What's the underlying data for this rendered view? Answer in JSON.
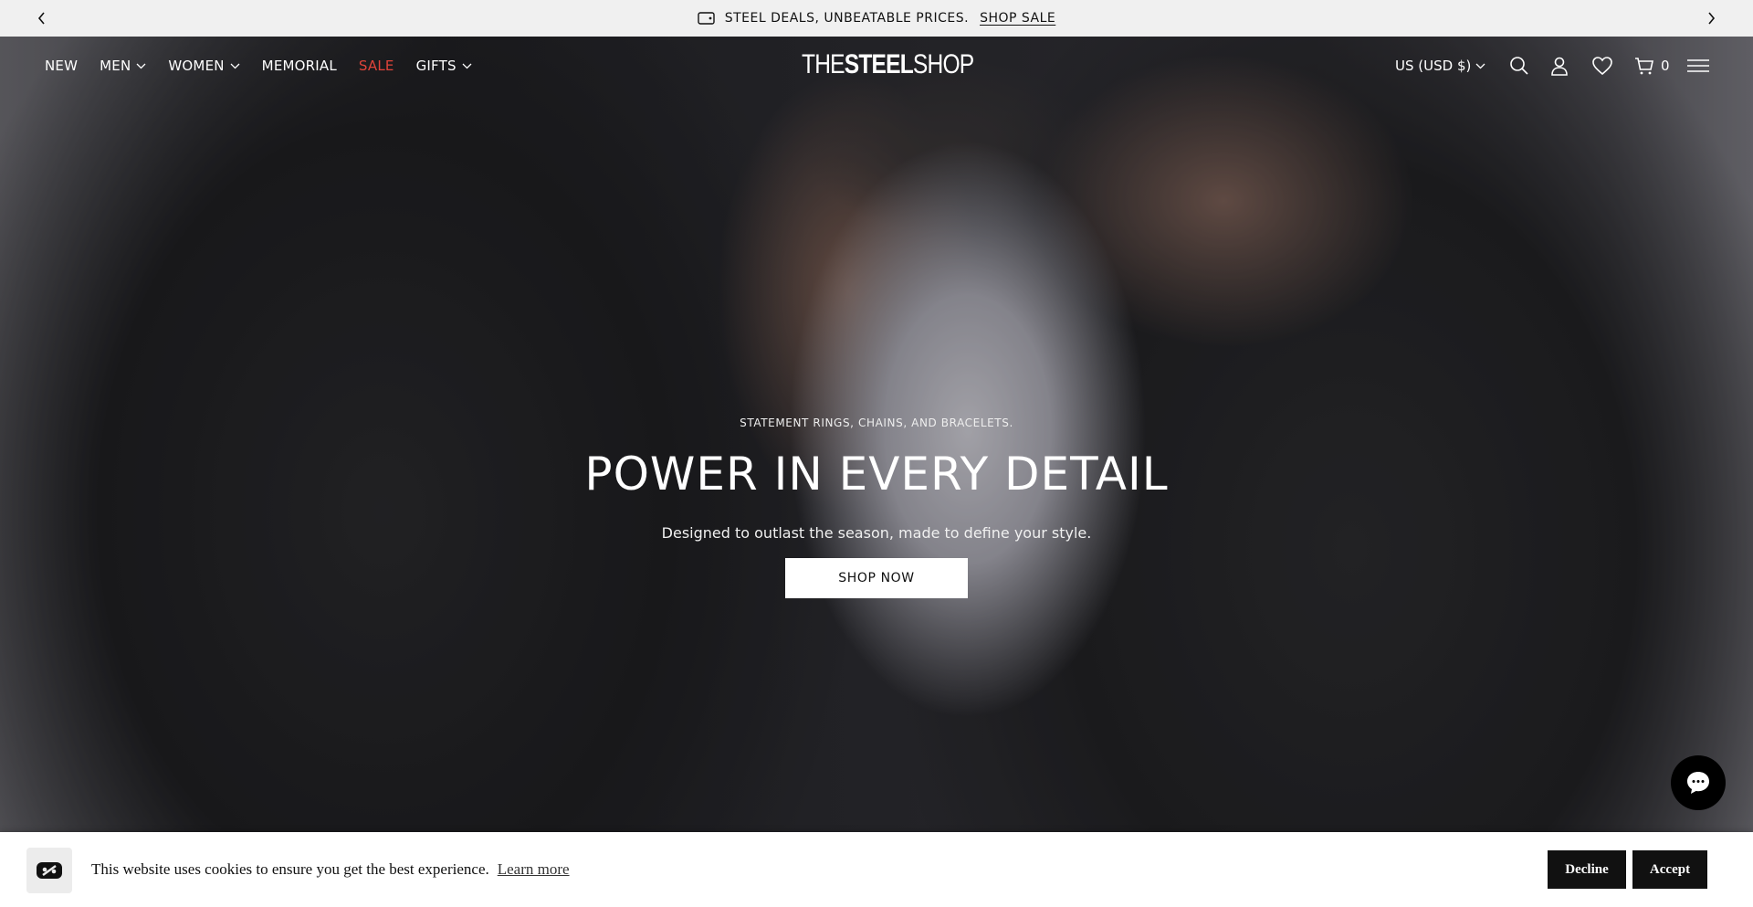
{
  "announcement": {
    "text": "STEEL DEALS, UNBEATABLE PRICES.",
    "link": "SHOP SALE"
  },
  "nav": {
    "items": [
      {
        "label": "NEW",
        "dropdown": false
      },
      {
        "label": "MEN",
        "dropdown": true
      },
      {
        "label": "WOMEN",
        "dropdown": true
      },
      {
        "label": "MEMORIAL",
        "dropdown": false
      },
      {
        "label": "SALE",
        "dropdown": false
      },
      {
        "label": "GIFTS",
        "dropdown": true
      }
    ],
    "logo_light": "THE",
    "logo_bold": "STEEL",
    "logo_end": "SHOP",
    "currency": "US (USD $)",
    "cart_count": "0",
    "icons": [
      "search-icon",
      "account-icon",
      "wishlist-icon",
      "cart-icon",
      "menu-icon"
    ]
  },
  "hero": {
    "eyebrow": "STATEMENT RINGS, CHAINS, AND BRACELETS.",
    "headline": "POWER IN EVERY DETAIL",
    "subtext": "Designed to outlast the season, made to define your style.",
    "cta": "SHOP NOW"
  },
  "cookie": {
    "icon_glyph": "",
    "message": "This website uses cookies to ensure you get the best experience.",
    "learn_more": "Learn more",
    "decline": "Decline",
    "accept": "Accept",
    "close_glyph": ""
  },
  "colors": {
    "sale": "#e0443a",
    "announcement_bg": "#f0f0f0",
    "button_dark": "#111111"
  }
}
